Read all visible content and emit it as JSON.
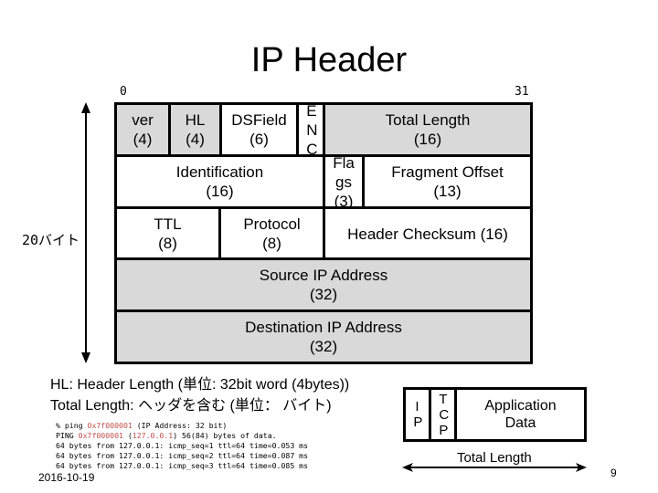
{
  "slide": {
    "title": "IP Header",
    "bit_start": "0",
    "bit_end": "31",
    "size_label": "20バイト",
    "colors": {
      "gray_field": "#d9d9d9",
      "white_field": "#ffffff",
      "highlight_text": "#c0504d"
    },
    "header_rows": [
      {
        "fields": [
          {
            "name": "ver",
            "bits": "(4)",
            "fill": "#d9d9d9"
          },
          {
            "name": "HL",
            "bits": "(4)",
            "fill": "#d9d9d9"
          },
          {
            "name": "DSField",
            "bits": "(6)",
            "fill": "#ffffff"
          },
          {
            "name": "ENC",
            "bits": "",
            "fill": "#ffffff"
          },
          {
            "name": "Total Length",
            "bits": "(16)",
            "fill": "#d9d9d9"
          }
        ]
      },
      {
        "fields": [
          {
            "name": "Identification",
            "bits": "(16)",
            "fill": "#ffffff"
          },
          {
            "name": "Flags",
            "bits": "(3)",
            "fill": "#ffffff"
          },
          {
            "name": "Fragment Offset",
            "bits": "(13)",
            "fill": "#ffffff"
          }
        ]
      },
      {
        "fields": [
          {
            "name": "TTL",
            "bits": "(8)",
            "fill": "#ffffff"
          },
          {
            "name": "Protocol",
            "bits": "(8)",
            "fill": "#ffffff"
          },
          {
            "name": "Header Checksum (16)",
            "bits": "",
            "fill": "#ffffff"
          }
        ]
      },
      {
        "fields": [
          {
            "name": "Source IP Address",
            "bits": "(32)",
            "fill": "#d9d9d9"
          }
        ]
      },
      {
        "fields": [
          {
            "name": "Destination IP Address",
            "bits": "(32)",
            "fill": "#d9d9d9"
          }
        ]
      }
    ],
    "notes": [
      "HL: Header Length (単位: 32bit word (4bytes))",
      "Total Length: ヘッダを含む (単位： バイト)"
    ],
    "ping_output": {
      "line1": {
        "prefix": "% ping ",
        "addr_hex": "0x7f000001",
        "suffix": " (IP Address: 32 bit)"
      },
      "line2": {
        "prefix": "PING ",
        "addr_hex": "0x7f000001",
        "mid": " (",
        "addr_dotted": "127.0.0.1",
        "suffix": ") 56(84) bytes of data."
      },
      "replies": [
        "64 bytes from 127.0.0.1: icmp_seq=1 ttl=64 time=0.053 ms",
        "64 bytes from 127.0.0.1: icmp_seq=2 ttl=64 time=0.087 ms",
        "64 bytes from 127.0.0.1: icmp_seq=3 ttl=64 time=0.085 ms"
      ]
    },
    "packet_diagram": {
      "segments": [
        "IP",
        "TCP",
        "Application Data"
      ],
      "application_lines": [
        "Application",
        "Data"
      ],
      "length_label": "Total Length"
    },
    "date": "2016-10-19",
    "page_number": "9"
  }
}
